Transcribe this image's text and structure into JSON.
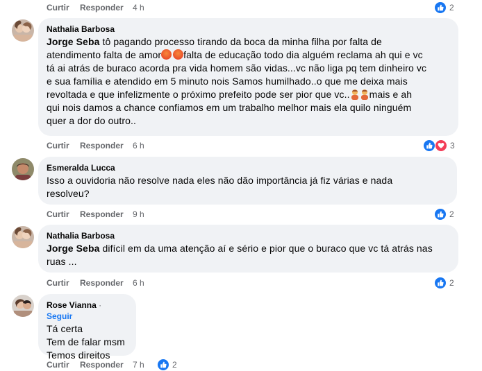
{
  "actions": {
    "like": "Curtir",
    "reply": "Responder"
  },
  "top_row": {
    "time": "4 h",
    "reaction_count": "2"
  },
  "comments": [
    {
      "author": "Nathalia Barbosa",
      "mention": "Jorge Seba",
      "lines": [
        " tô pagando processo tirando da boca da minha filha por falta de",
        "atendimento falta de amor",
        "falta de educação todo dia alguém reclama ah qui e vc",
        "tá ai atrás de buraco acorda pra vida homem são vidas...vc não liga pq tem dinheiro vc",
        "e sua família e atendido em 5 minuto nois Samos humilhado..o que me deixa mais",
        "revoltada e que infelizmente o próximo prefeito pode ser pior que vc..",
        "mais e ah",
        "qui nois damos a chance confiamos em um trabalho melhor mais ela quilo ninguém",
        "quer a dor do outro.."
      ],
      "time": "6 h",
      "reaction_count": "3",
      "reactions": [
        "like-icon",
        "love-icon"
      ]
    },
    {
      "author": "Esmeralda Lucca",
      "lines": [
        "Isso a ouvidoria não resolve nada eles não dão importância já fiz várias e nada",
        "resolveu?"
      ],
      "time": "9 h",
      "reaction_count": "2"
    },
    {
      "author": "Nathalia Barbosa",
      "mention": "Jorge Seba",
      "lines": [
        " difícil em da uma atenção aí e sério e pior que o buraco que vc tá atrás nas",
        "ruas ..."
      ],
      "time": "6 h",
      "reaction_count": "2"
    },
    {
      "author": "Rose Vianna",
      "follow": "Seguir",
      "dot": " · ",
      "lines": [
        "Tá certa",
        "Tem de falar msm",
        "Temos direitos"
      ],
      "time": "7 h",
      "reaction_count": "2"
    }
  ],
  "colors": {
    "bubble": "#f0f2f5",
    "like": "#1877f2",
    "love": "#f33e58",
    "meta": "#65676b"
  }
}
